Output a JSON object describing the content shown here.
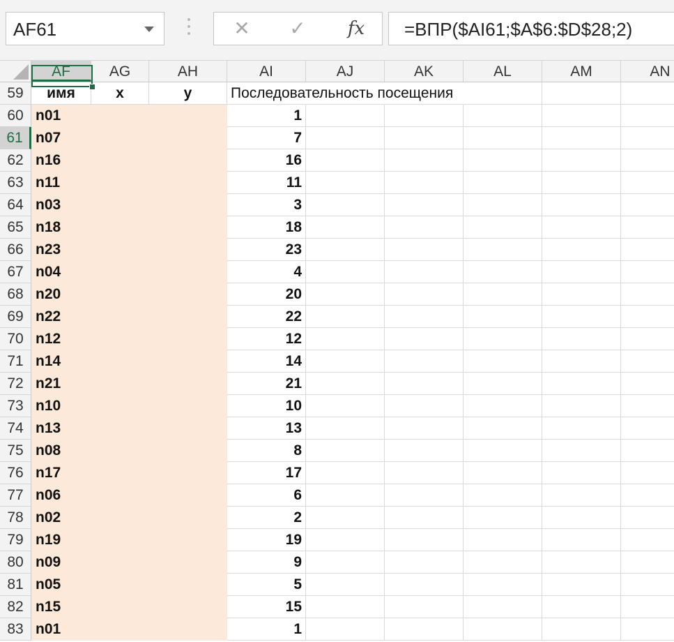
{
  "name_box": "AF61",
  "formula": "=ВПР($AI61;$A$6:$D$28;2)",
  "toolbar": {
    "cancel_icon": "cancel-icon",
    "enter_icon": "check-icon",
    "fx_label": "fx"
  },
  "columns": [
    "AF",
    "AG",
    "AH",
    "AI",
    "AJ",
    "AK",
    "AL",
    "AM",
    "AN"
  ],
  "active_column": "AF",
  "active_row": "61",
  "header_row": {
    "row": "59",
    "af": "имя",
    "ag": "x",
    "ah": "y",
    "ai": "Последовательность посещения"
  },
  "rows": [
    {
      "row": "60",
      "name": "n01",
      "seq": "1"
    },
    {
      "row": "61",
      "name": "n07",
      "seq": "7"
    },
    {
      "row": "62",
      "name": "n16",
      "seq": "16"
    },
    {
      "row": "63",
      "name": "n11",
      "seq": "11"
    },
    {
      "row": "64",
      "name": "n03",
      "seq": "3"
    },
    {
      "row": "65",
      "name": "n18",
      "seq": "18"
    },
    {
      "row": "66",
      "name": "n23",
      "seq": "23"
    },
    {
      "row": "67",
      "name": "n04",
      "seq": "4"
    },
    {
      "row": "68",
      "name": "n20",
      "seq": "20"
    },
    {
      "row": "69",
      "name": "n22",
      "seq": "22"
    },
    {
      "row": "70",
      "name": "n12",
      "seq": "12"
    },
    {
      "row": "71",
      "name": "n14",
      "seq": "14"
    },
    {
      "row": "72",
      "name": "n21",
      "seq": "21"
    },
    {
      "row": "73",
      "name": "n10",
      "seq": "10"
    },
    {
      "row": "74",
      "name": "n13",
      "seq": "13"
    },
    {
      "row": "75",
      "name": "n08",
      "seq": "8"
    },
    {
      "row": "76",
      "name": "n17",
      "seq": "17"
    },
    {
      "row": "77",
      "name": "n06",
      "seq": "6"
    },
    {
      "row": "78",
      "name": "n02",
      "seq": "2"
    },
    {
      "row": "79",
      "name": "n19",
      "seq": "19"
    },
    {
      "row": "80",
      "name": "n09",
      "seq": "9"
    },
    {
      "row": "81",
      "name": "n05",
      "seq": "5"
    },
    {
      "row": "82",
      "name": "n15",
      "seq": "15"
    },
    {
      "row": "83",
      "name": "n01",
      "seq": "1"
    }
  ],
  "colors": {
    "accent": "#1f6e43",
    "shade": "#fde9d9"
  }
}
